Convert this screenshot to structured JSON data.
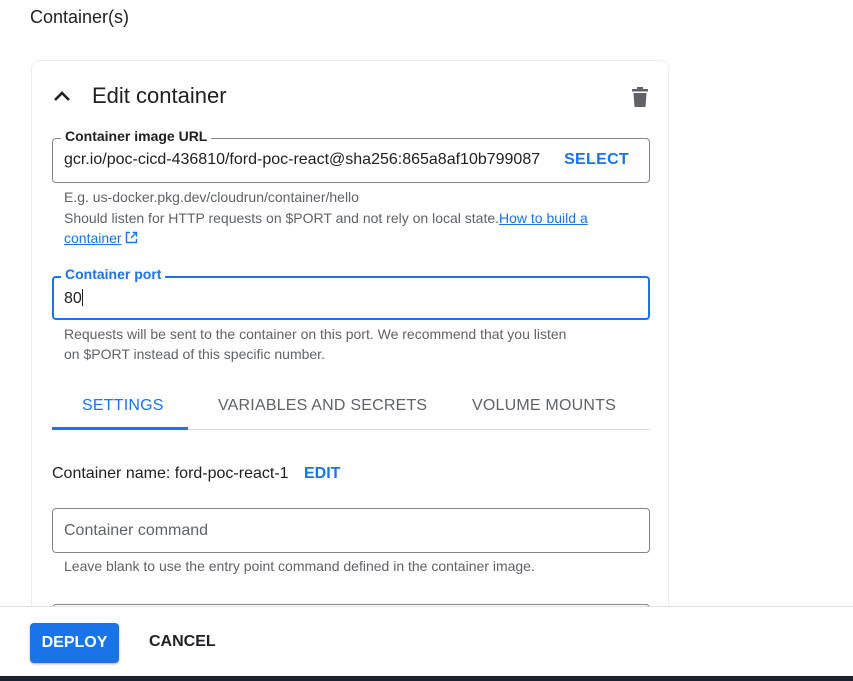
{
  "section": {
    "title": "Container(s)"
  },
  "card": {
    "title": "Edit container",
    "image_field": {
      "label": "Container image URL",
      "value": "gcr.io/poc-cicd-436810/ford-poc-react@sha256:865a8af10b799087",
      "select_label": "SELECT"
    },
    "image_hint": {
      "example": "E.g. us-docker.pkg.dev/cloudrun/container/hello",
      "text": "Should listen for HTTP requests on $PORT and not rely on local state.",
      "link_part1": "How to build a",
      "link_part2": "container"
    },
    "port_field": {
      "label": "Container port",
      "value": "80"
    },
    "port_hint": {
      "line1": "Requests will be sent to the container on this port. We recommend that you listen",
      "line2": "on $PORT instead of this specific number."
    },
    "tabs": [
      {
        "label": "SETTINGS",
        "active": true
      },
      {
        "label": "VARIABLES AND SECRETS",
        "active": false
      },
      {
        "label": "VOLUME MOUNTS",
        "active": false
      }
    ],
    "container_name": {
      "text": "Container name: ford-poc-react-1",
      "edit_label": "EDIT"
    },
    "command_field": {
      "placeholder": "Container command",
      "hint": "Leave blank to use the entry point command defined in the container image."
    }
  },
  "footer": {
    "deploy_label": "DEPLOY",
    "cancel_label": "CANCEL"
  },
  "icons": {
    "collapse": "chevron-up-icon",
    "delete": "trash-icon",
    "external": "open-in-new-icon"
  },
  "colors": {
    "accent": "#1a73e8",
    "text": "#202124",
    "secondary_text": "#5f6368",
    "border": "#80868b"
  }
}
